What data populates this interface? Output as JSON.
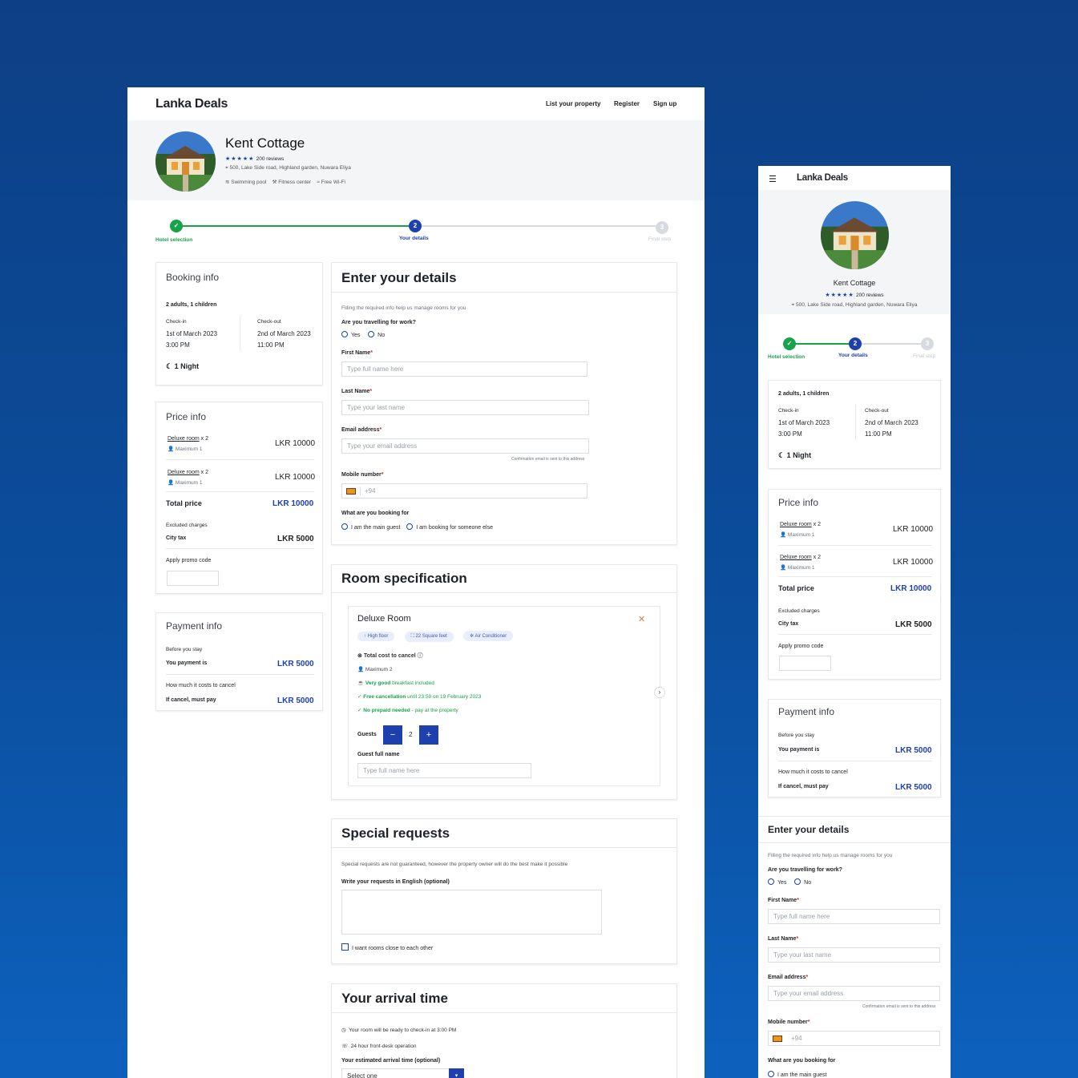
{
  "brand": "Lanka Deals",
  "nav": {
    "list": "List your property",
    "register": "Register",
    "signup": "Sign up"
  },
  "hotel": {
    "name": "Kent Cottage",
    "reviews": "200 reviews",
    "address": "500, Lake Side road, Highland garden, Nuwara Eliya",
    "amenities": [
      "Swimming pool",
      "Fitness center",
      "Free Wi-Fi"
    ]
  },
  "steps": {
    "s1": "Hotel selection",
    "s2": "Your details",
    "s3": "Final step",
    "n2": "2",
    "n3": "3"
  },
  "booking": {
    "title": "Booking info",
    "guests": "2 adults, 1 children",
    "checkin_label": "Check-in",
    "checkin_date": "1st of March 2023",
    "checkin_time": "3:00 PM",
    "checkout_label": "Check-out",
    "checkout_date": "2nd of March 2023",
    "checkout_time": "11:00 PM",
    "nights": "1 Night"
  },
  "price": {
    "title": "Price info",
    "room": "Deluxe room",
    "qty": " x 2",
    "max": "Maximum 1",
    "room_price": "LKR 10000",
    "total_label": "Total price",
    "total": "LKR 10000",
    "excluded": "Excluded charges",
    "tax_label": "City tax",
    "tax": "LKR 5000",
    "promo": "Apply promo code"
  },
  "payment": {
    "title": "Payment info",
    "before": "Before you stay",
    "pay_label": "You payment is",
    "pay": "LKR 5000",
    "cancel_q": "How much it costs to cancel",
    "cancel_label": "If cancel, must pay",
    "cancel": "LKR 5000"
  },
  "details": {
    "title": "Enter your details",
    "intro": "Filling the required info help us manage rooms for you",
    "work_q": "Are you travelling for work?",
    "yes": "Yes",
    "no": "No",
    "first_label": "First Name",
    "first_ph": "Type full name here",
    "last_label": "Last Name",
    "last_ph": "Type your last name",
    "email_label": "Email address",
    "email_ph": "Type your email address",
    "email_note": "Confirmation email is sent to this address",
    "mobile_label": "Mobile number",
    "mobile_ph": "+94",
    "booking_for": "What are you booking for",
    "main_guest": "I am the main guest",
    "someone": "I am booking for someone else",
    "star": "*"
  },
  "room": {
    "title": "Room specification",
    "name": "Deluxe Room",
    "pills": [
      "High floor",
      "22 Square feet",
      "Air Conditioner"
    ],
    "cost_cancel": "Total cost to cancel",
    "maximum": "Maximum 2",
    "breakfast_b": "Very good",
    "breakfast": " breakfast included",
    "free_b": "Free cancellation",
    "free": " until 23:59 on 19 February 2023",
    "prepaid_b": "No prepaid needed",
    "prepaid": " - pay at the property",
    "guests_label": "Guests",
    "guests_val": "2",
    "minus": "−",
    "plus": "+",
    "guest_name": "Guest full name",
    "guest_ph": "Type full name here"
  },
  "special": {
    "title": "Special requests",
    "intro": "Special requests are not guaranteed, however the property owner will do the best make it possible",
    "write": "Write your requests in English (optional)",
    "close": "I want rooms close to each other"
  },
  "arrival": {
    "title": "Your arrival time",
    "ready": "Your room will be ready to check-in at 3:00 PM",
    "desk": "24 hour front-desk operation",
    "est": "Your estimated arrival time (optional)",
    "select": "Select one"
  },
  "colors": {
    "primary": "#1e40af",
    "success": "#16a34a",
    "bg": "#0b4d9c"
  }
}
